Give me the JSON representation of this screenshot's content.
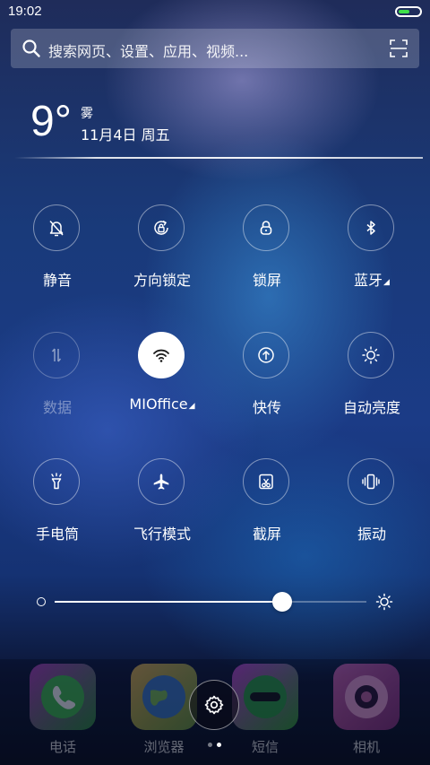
{
  "status_bar": {
    "time": "19:02",
    "battery_level": 0.55,
    "battery_color": "#3fe04a"
  },
  "search": {
    "placeholder": "搜索网页、设置、应用、视频...",
    "icon": "search-icon",
    "scan_icon": "scan-icon"
  },
  "weather": {
    "temperature": "9°",
    "condition": "雾",
    "date": "11月4日 周五"
  },
  "toggles": [
    {
      "label": "静音",
      "icon": "silent-bell-icon",
      "active": false,
      "enabled": true
    },
    {
      "label": "方向锁定",
      "icon": "rotation-lock-icon",
      "active": false,
      "enabled": true
    },
    {
      "label": "锁屏",
      "icon": "lock-icon",
      "active": false,
      "enabled": true
    },
    {
      "label": "蓝牙",
      "icon": "bluetooth-icon",
      "active": false,
      "enabled": true,
      "has_menu": true
    },
    {
      "label": "数据",
      "icon": "mobile-data-icon",
      "active": false,
      "enabled": false
    },
    {
      "label": "MIOffice",
      "icon": "wifi-icon",
      "active": true,
      "enabled": true,
      "has_menu": true
    },
    {
      "label": "快传",
      "icon": "quick-transfer-icon",
      "active": false,
      "enabled": true
    },
    {
      "label": "自动亮度",
      "icon": "auto-brightness-icon",
      "active": false,
      "enabled": true
    },
    {
      "label": "手电筒",
      "icon": "flashlight-icon",
      "active": false,
      "enabled": true
    },
    {
      "label": "飞行模式",
      "icon": "airplane-icon",
      "active": false,
      "enabled": true
    },
    {
      "label": "截屏",
      "icon": "screenshot-icon",
      "active": false,
      "enabled": true
    },
    {
      "label": "振动",
      "icon": "vibrate-icon",
      "active": false,
      "enabled": true
    }
  ],
  "brightness": {
    "level": 0.73
  },
  "dock": {
    "apps": [
      {
        "label": "电话",
        "icon": "phone-icon",
        "color": "#2a8f3a"
      },
      {
        "label": "浏览器",
        "icon": "browser-icon",
        "color": "#d8a040"
      },
      {
        "label": "短信",
        "icon": "messages-icon",
        "color": "#b040c8"
      },
      {
        "label": "相机",
        "icon": "camera-icon",
        "color": "#c24aa0"
      }
    ],
    "page_count": 2,
    "current_page": 2
  }
}
